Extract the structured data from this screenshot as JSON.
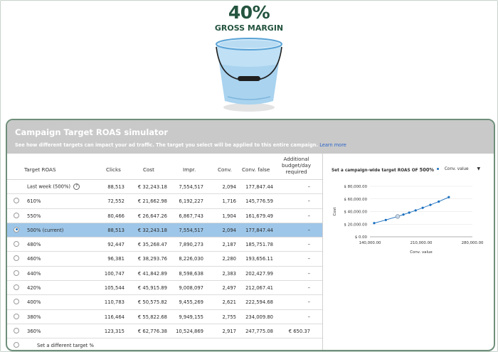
{
  "hero": {
    "percent": "40%",
    "label": "GROSS MARGIN"
  },
  "panel": {
    "title": "Campaign Target ROAS simulator",
    "description": "See how different targets can impact your ad traffic. The target you select will be applied to this entire campaign.",
    "learn_more": "Learn more"
  },
  "table": {
    "headers": {
      "target": "Target ROAS",
      "clicks": "Clicks",
      "cost": "Cost",
      "impr": "Impr.",
      "conv": "Conv.",
      "convfalse": "Conv. false",
      "budget_l1": "Additional",
      "budget_l2": "budget/day",
      "budget_l3": "required"
    },
    "lastweek": {
      "label": "Last week (500%)",
      "help": "?",
      "clicks": "88,513",
      "cost": "€ 32,243.18",
      "impr": "7,554,517",
      "conv": "2,094",
      "convfalse": "177,847.44",
      "budget": "–"
    },
    "rows": [
      {
        "target": "610%",
        "clicks": "72,552",
        "cost": "€ 21,662.98",
        "impr": "6,192,227",
        "conv": "1,716",
        "convfalse": "145,776.59",
        "budget": "–",
        "selected": false
      },
      {
        "target": "550%",
        "clicks": "80,466",
        "cost": "€ 26,647.26",
        "impr": "6,867,743",
        "conv": "1,904",
        "convfalse": "161,679.49",
        "budget": "–",
        "selected": false
      },
      {
        "target": "500% (current)",
        "clicks": "88,513",
        "cost": "€ 32,243.18",
        "impr": "7,554,517",
        "conv": "2,094",
        "convfalse": "177,847.44",
        "budget": "–",
        "selected": true
      },
      {
        "target": "480%",
        "clicks": "92,447",
        "cost": "€ 35,268.47",
        "impr": "7,890,273",
        "conv": "2,187",
        "convfalse": "185,751.78",
        "budget": "–",
        "selected": false
      },
      {
        "target": "460%",
        "clicks": "96,381",
        "cost": "€ 38,293.76",
        "impr": "8,226,030",
        "conv": "2,280",
        "convfalse": "193,656.11",
        "budget": "–",
        "selected": false
      },
      {
        "target": "440%",
        "clicks": "100,747",
        "cost": "€ 41,842.89",
        "impr": "8,598,638",
        "conv": "2,383",
        "convfalse": "202,427.99",
        "budget": "–",
        "selected": false
      },
      {
        "target": "420%",
        "clicks": "105,544",
        "cost": "€ 45,915.89",
        "impr": "9,008,097",
        "conv": "2,497",
        "convfalse": "212,067.41",
        "budget": "–",
        "selected": false
      },
      {
        "target": "400%",
        "clicks": "110,783",
        "cost": "€ 50,575.82",
        "impr": "9,455,269",
        "conv": "2,621",
        "convfalse": "222,594.68",
        "budget": "–",
        "selected": false
      },
      {
        "target": "380%",
        "clicks": "116,464",
        "cost": "€ 55,822.68",
        "impr": "9,949,155",
        "conv": "2,755",
        "convfalse": "234,009.80",
        "budget": "–",
        "selected": false
      },
      {
        "target": "360%",
        "clicks": "123,315",
        "cost": "€ 62,776.38",
        "impr": "10,524,869",
        "conv": "2,917",
        "convfalse": "247,775.08",
        "budget": "€ 650.37",
        "selected": false
      }
    ],
    "different_target": "Set a different target %"
  },
  "chart_header": {
    "title_prefix": "Set a campaign-wide target ROAS OF",
    "title_value": "500%",
    "legend": "Conv. value",
    "dropdown": "▼"
  },
  "chart_data": {
    "type": "line",
    "series": [
      {
        "name": "Conv. value",
        "color": "#1a6fbf",
        "x": [
          145776.59,
          161679.49,
          177847.44,
          185751.78,
          193656.11,
          202427.99,
          212067.41,
          222594.68,
          234009.8,
          247775.08
        ],
        "y": [
          21662.98,
          26647.26,
          32243.18,
          35268.47,
          38293.76,
          41842.89,
          45915.89,
          50575.82,
          55822.68,
          62776.38
        ]
      }
    ],
    "highlight_index": 2,
    "xlabel": "Conv. value",
    "ylabel": "Cost",
    "xlim": [
      140000,
      280000
    ],
    "ylim": [
      0,
      80000
    ],
    "xticks": [
      "140,000.00",
      "210,000.00",
      "280,000.00"
    ],
    "yticks": [
      "$ 0.00",
      "$ 20,000.00",
      "$ 40,000.00",
      "$ 60,000.00",
      "$ 80,000.00"
    ],
    "grid": true
  }
}
